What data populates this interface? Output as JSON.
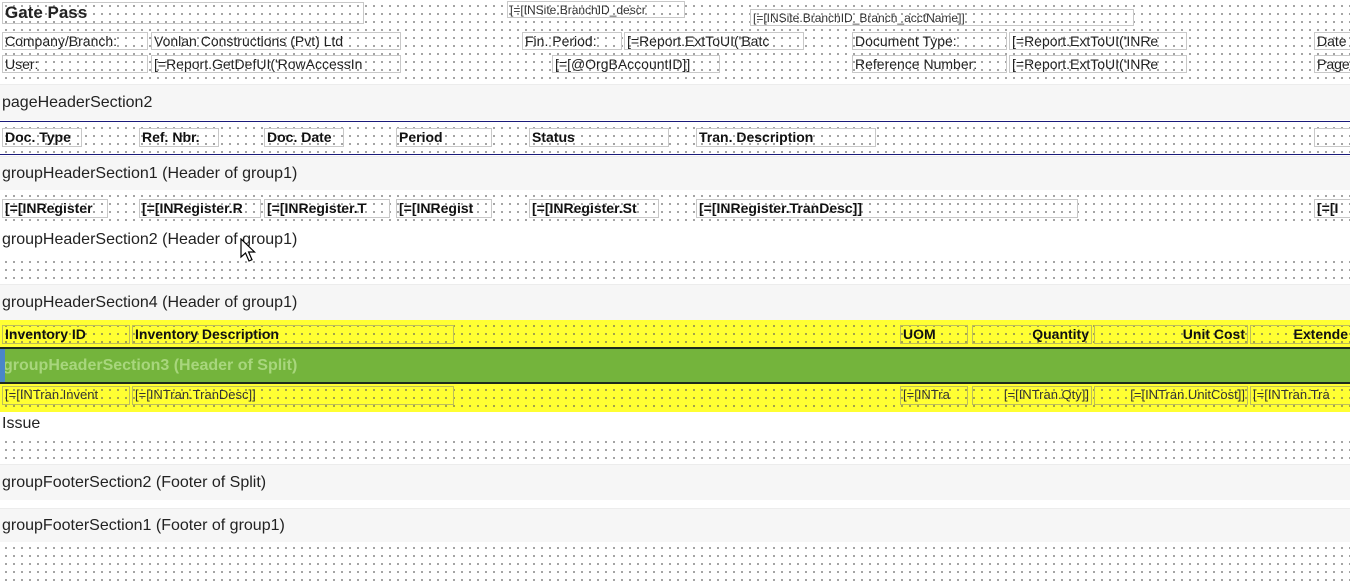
{
  "page_header": {
    "title": "Gate Pass",
    "branch_descr": "[=[INSite.BranchID_descr",
    "branch_acct": "[=[INSite.BranchID_Branch_acctName]]",
    "company_label": "Company/Branch:",
    "company_value": "Vonlan Constructions (Pvt) Ltd",
    "fin_period_label": "Fin. Period:",
    "fin_period_value": "[=Report.ExtToUI('Batc",
    "doc_type_label": "Document Type:",
    "doc_type_value": "[=Report.ExtToUI('INRe",
    "date_label": "Date",
    "user_label": "User:",
    "user_value": "[=Report.GetDefUI('RowAccessIn",
    "org_account": "[=[@OrgBAccountID]]",
    "ref_number_label": "Reference Number:",
    "ref_number_value": "[=Report.ExtToUI('INRe",
    "page_label": "Page"
  },
  "sections": {
    "page_header_2": "pageHeaderSection2",
    "group_header_1": "groupHeaderSection1 (Header of group1)",
    "group_header_2": "groupHeaderSection2 (Header of group1)",
    "group_header_4": "groupHeaderSection4 (Header of group1)",
    "group_header_3": "groupHeaderSection3 (Header of Split)",
    "issue": "Issue",
    "group_footer_2": "groupFooterSection2 (Footer of Split)",
    "group_footer_1": "groupFooterSection1 (Footer of group1)"
  },
  "column_headers": {
    "doc_type": "Doc. Type",
    "ref_nbr": "Ref. Nbr.",
    "doc_date": "Doc. Date",
    "period": "Period",
    "status": "Status",
    "tran_desc": "Tran. Description"
  },
  "register_fields": {
    "f1": "[=[INRegister",
    "f2": "[=[INRegister.R",
    "f3": "[=[INRegister.T",
    "f4": "[=[INRegist",
    "f5": "[=[INRegister.St",
    "f6": "[=[INRegister.TranDesc]]",
    "f7": "[=[I"
  },
  "line_headers": {
    "inventory_id": "Inventory ID",
    "inventory_desc": "Inventory Description",
    "uom": "UOM",
    "quantity": "Quantity",
    "unit_cost": "Unit Cost",
    "extended": "Extende"
  },
  "line_fields": {
    "inventory_id": "[=[INTran.Invent",
    "tran_desc": "[=[INTran.TranDesc]]",
    "uom": "[=[INTra",
    "qty": "[=[INTran.Qty]]",
    "unit_cost": "[=[INTran.UnitCost]]",
    "ext": "[=[INTran.Tra"
  },
  "colors": {
    "band": "#f6f6f6",
    "highlight_yellow": "#ffff33",
    "split_green": "#74b43c",
    "rule_navy": "#1a1a7a"
  }
}
